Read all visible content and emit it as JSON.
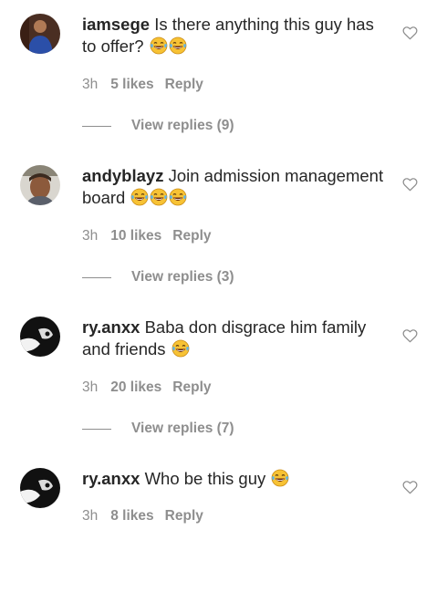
{
  "comments": [
    {
      "username": "iamsege",
      "text": "Is there anything this guy has to offer?",
      "emoji_count": 2,
      "time": "3h",
      "likes": "5 likes",
      "reply": "Reply",
      "view_replies": "View replies (9)",
      "avatar": "avatar-photo-blue-shirt"
    },
    {
      "username": "andyblayz",
      "text": "Join admission management board",
      "emoji_count": 3,
      "time": "3h",
      "likes": "10 likes",
      "reply": "Reply",
      "view_replies": "View replies (3)",
      "avatar": "avatar-photo-face"
    },
    {
      "username": "ry.anxx",
      "text": "Baba don disgrace him family and friends",
      "emoji_count": 1,
      "time": "3h",
      "likes": "20 likes",
      "reply": "Reply",
      "view_replies": "View replies (7)",
      "avatar": "avatar-photo-black-white"
    },
    {
      "username": "ry.anxx",
      "text": "Who be this guy",
      "emoji_count": 1,
      "time": "3h",
      "likes": "8 likes",
      "reply": "Reply",
      "avatar": "avatar-photo-black-white"
    }
  ],
  "icons": {
    "like": "heart-outline-icon",
    "emoji": "face-with-tears-of-joy"
  },
  "colors": {
    "text": "#262626",
    "muted": "#8e8e8e",
    "emoji_face": "#f7c234"
  }
}
